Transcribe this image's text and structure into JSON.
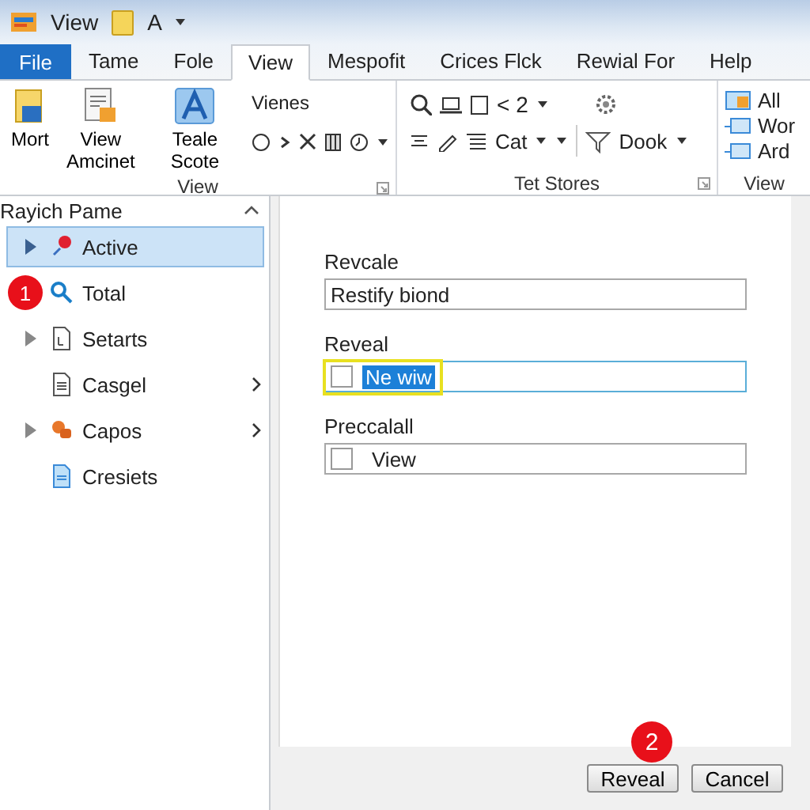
{
  "title_bar": {
    "title": "View",
    "document": "A"
  },
  "tabs": [
    {
      "label": "File",
      "kind": "file",
      "selected": false
    },
    {
      "label": "Tame",
      "kind": "tab",
      "selected": false
    },
    {
      "label": "Fole",
      "kind": "tab",
      "selected": false
    },
    {
      "label": "View",
      "kind": "tab",
      "selected": true
    },
    {
      "label": "Mespofit",
      "kind": "tab",
      "selected": false
    },
    {
      "label": "Crices Flck",
      "kind": "tab",
      "selected": false
    },
    {
      "label": "Rewial For",
      "kind": "tab",
      "selected": false
    },
    {
      "label": "Help",
      "kind": "tab",
      "selected": false
    }
  ],
  "ribbon": {
    "groups": [
      {
        "label": "View",
        "launcher": true,
        "large_buttons": [
          {
            "lines": [
              "Mort"
            ]
          },
          {
            "lines": [
              "View",
              "Amcinet"
            ]
          },
          {
            "lines": [
              "Teale Scote"
            ]
          }
        ],
        "column_title": "Vienes"
      },
      {
        "label": "Tet Stores",
        "launcher": true,
        "row_1_text": "< 2",
        "row_2_items": [
          "Cat",
          "Dook"
        ]
      },
      {
        "label": "View",
        "launcher": false,
        "list": [
          "All",
          "Wor",
          "Ard"
        ]
      }
    ]
  },
  "navigation_pane": {
    "title": "Rayich Pame",
    "items": [
      {
        "label": "Active",
        "selected": true,
        "expandable": true,
        "submenu": false
      },
      {
        "label": "Total",
        "selected": false,
        "expandable": false,
        "submenu": false,
        "badge": "1"
      },
      {
        "label": "Setarts",
        "selected": false,
        "expandable": true,
        "submenu": false
      },
      {
        "label": "Casgel",
        "selected": false,
        "expandable": false,
        "submenu": true
      },
      {
        "label": "Capos",
        "selected": false,
        "expandable": true,
        "submenu": true
      },
      {
        "label": "Cresiets",
        "selected": false,
        "expandable": false,
        "submenu": false
      }
    ]
  },
  "form": {
    "fields": [
      {
        "label": "Revcale",
        "kind": "text",
        "value": "Restify biond",
        "focused": false
      },
      {
        "label": "Reveal",
        "kind": "checkbox",
        "value": "Ne wiw",
        "checked": false,
        "focused": true
      },
      {
        "label": "Preccalall",
        "kind": "checkbox",
        "value": "View",
        "checked": false,
        "focused": false
      }
    ]
  },
  "footer": {
    "badge": "2",
    "buttons": [
      "Reveal",
      "Cancel"
    ]
  }
}
